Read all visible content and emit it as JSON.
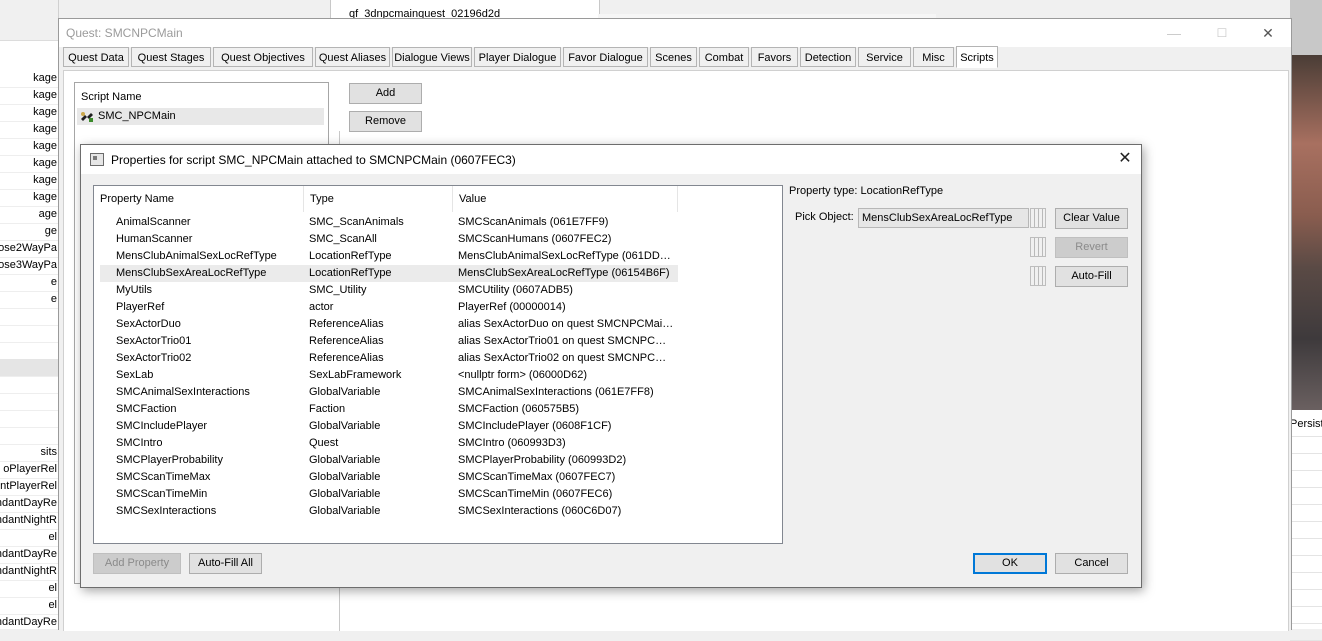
{
  "background": {
    "left_list": [
      "kage",
      "kage",
      "kage",
      "kage",
      "kage",
      "kage",
      "kage",
      "kage",
      "age",
      "ge",
      "pose2WayPa",
      "pose3WayPa",
      "e",
      "e",
      "",
      "",
      "",
      "",
      "",
      "",
      "",
      "",
      "sits",
      "oPlayerRel",
      "ntPlayerRel",
      "ndantDayRe",
      "ndantNightR",
      "el",
      "ndantDayRe",
      "ndantNightR",
      "el",
      "el",
      "ndantDayRe"
    ],
    "popup_text": "qf_3dnpcmainquest_02196d2d",
    "right_column_label": "Persist"
  },
  "quest_window": {
    "title": "Quest: SMCNPCMain",
    "controls": {
      "minimize": "—",
      "maximize": "☐",
      "close": "✕"
    },
    "tabs": [
      "Quest Data",
      "Quest Stages",
      "Quest Objectives",
      "Quest Aliases",
      "Dialogue Views",
      "Player Dialogue",
      "Favor Dialogue",
      "Scenes",
      "Combat",
      "Favors",
      "Detection",
      "Service",
      "Misc",
      "Scripts"
    ],
    "active_tab": "Scripts",
    "script_list": {
      "header": "Script Name",
      "items": [
        "SMC_NPCMain"
      ]
    },
    "buttons": {
      "add": "Add",
      "remove": "Remove"
    }
  },
  "properties_dialog": {
    "title": "Properties for script SMC_NPCMain attached to SMCNPCMain (0607FEC3)",
    "close": "✕",
    "columns": [
      "Property Name",
      "Type",
      "Value"
    ],
    "rows": [
      {
        "name": "AnimalScanner",
        "type": "SMC_ScanAnimals",
        "value": "SMCScanAnimals (061E7FF9)"
      },
      {
        "name": "HumanScanner",
        "type": "SMC_ScanAll",
        "value": "SMCScanHumans (0607FEC2)"
      },
      {
        "name": "MensClubAnimalSexLocRefType",
        "type": "LocationRefType",
        "value": "MensClubAnimalSexLocRefType (061DDD…"
      },
      {
        "name": "MensClubSexAreaLocRefType",
        "type": "LocationRefType",
        "value": "MensClubSexAreaLocRefType (06154B6F)"
      },
      {
        "name": "MyUtils",
        "type": "SMC_Utility",
        "value": "SMCUtility (0607ADB5)"
      },
      {
        "name": "PlayerRef",
        "type": "actor",
        "value": "PlayerRef (00000014)"
      },
      {
        "name": "SexActorDuo",
        "type": "ReferenceAlias",
        "value": "alias SexActorDuo on quest SMCNPCMain …"
      },
      {
        "name": "SexActorTrio01",
        "type": "ReferenceAlias",
        "value": "alias SexActorTrio01 on quest SMCNPCMa…"
      },
      {
        "name": "SexActorTrio02",
        "type": "ReferenceAlias",
        "value": "alias SexActorTrio02 on quest SMCNPCMa…"
      },
      {
        "name": "SexLab",
        "type": "SexLabFramework",
        "value": "<nullptr form> (06000D62)"
      },
      {
        "name": "SMCAnimalSexInteractions",
        "type": "GlobalVariable",
        "value": "SMCAnimalSexInteractions (061E7FF8)"
      },
      {
        "name": "SMCFaction",
        "type": "Faction",
        "value": "SMCFaction (060575B5)"
      },
      {
        "name": "SMCIncludePlayer",
        "type": "GlobalVariable",
        "value": "SMCIncludePlayer (0608F1CF)"
      },
      {
        "name": "SMCIntro",
        "type": "Quest",
        "value": "SMCIntro (060993D3)"
      },
      {
        "name": "SMCPlayerProbability",
        "type": "GlobalVariable",
        "value": "SMCPlayerProbability (060993D2)"
      },
      {
        "name": "SMCScanTimeMax",
        "type": "GlobalVariable",
        "value": "SMCScanTimeMax (0607FEC7)"
      },
      {
        "name": "SMCScanTimeMin",
        "type": "GlobalVariable",
        "value": "SMCScanTimeMin (0607FEC6)"
      },
      {
        "name": "SMCSexInteractions",
        "type": "GlobalVariable",
        "value": "SMCSexInteractions (060C6D07)"
      }
    ],
    "selected_row": "MensClubSexAreaLocRefType",
    "property_type": "Property type: LocationRefType",
    "pick_object_label": "Pick Object:",
    "pick_object_value": "MensClubSexAreaLocRefType",
    "buttons": {
      "clear_value": "Clear Value",
      "revert": "Revert",
      "auto_fill": "Auto-Fill",
      "add_property": "Add Property",
      "auto_fill_all": "Auto-Fill All",
      "ok": "OK",
      "cancel": "Cancel"
    }
  }
}
